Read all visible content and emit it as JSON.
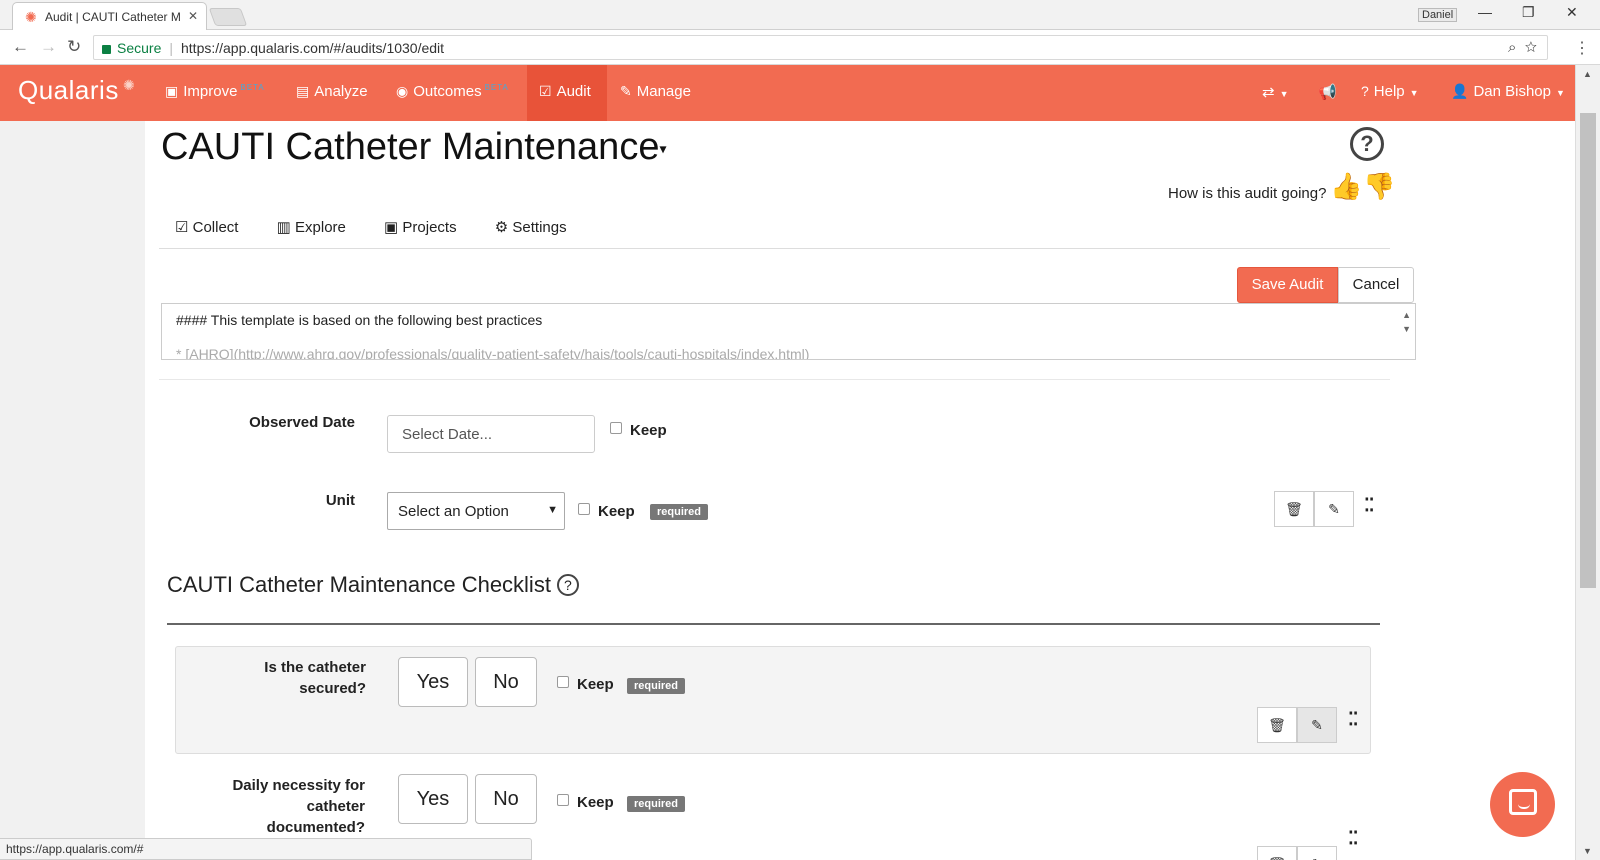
{
  "browser": {
    "tab_title": "Audit | CAUTI Catheter M",
    "profile_name": "Daniel",
    "secure_label": "Secure",
    "url": "https://app.qualaris.com/#/audits/1030/edit",
    "status_url": "https://app.qualaris.com/#"
  },
  "navbar": {
    "brand": "Qualaris",
    "items": [
      {
        "label": "Improve",
        "badge": "BETA"
      },
      {
        "label": "Analyze"
      },
      {
        "label": "Outcomes",
        "badge": "BETA"
      },
      {
        "label": "Audit"
      },
      {
        "label": "Manage"
      }
    ],
    "right": {
      "help": "Help",
      "user": "Dan Bishop"
    }
  },
  "page": {
    "title": "CAUTI Catheter Maintenance",
    "feedback_prompt": "How is this audit going?",
    "subnav": [
      "Collect",
      "Explore",
      "Projects",
      "Settings"
    ],
    "save_label": "Save Audit",
    "cancel_label": "Cancel",
    "description_line1": "#### This template is based on the following best practices",
    "description_line2": "* [AHRQ](http://www.ahrq.gov/professionals/quality-patient-safety/hais/tools/cauti-hospitals/index.html)"
  },
  "fields": {
    "observed_date": {
      "label": "Observed Date",
      "placeholder": "Select Date...",
      "keep": "Keep"
    },
    "unit": {
      "label": "Unit",
      "value": "Select an Option",
      "keep": "Keep",
      "required": "required"
    }
  },
  "checklist": {
    "title": "CAUTI Catheter Maintenance Checklist",
    "questions": [
      {
        "line1": "Is the catheter",
        "line2": "secured?",
        "yes": "Yes",
        "no": "No",
        "keep": "Keep",
        "required": "required"
      },
      {
        "line1": "Daily necessity for",
        "line2": "catheter documented?",
        "yes": "Yes",
        "no": "No",
        "keep": "Keep",
        "required": "required"
      }
    ]
  }
}
